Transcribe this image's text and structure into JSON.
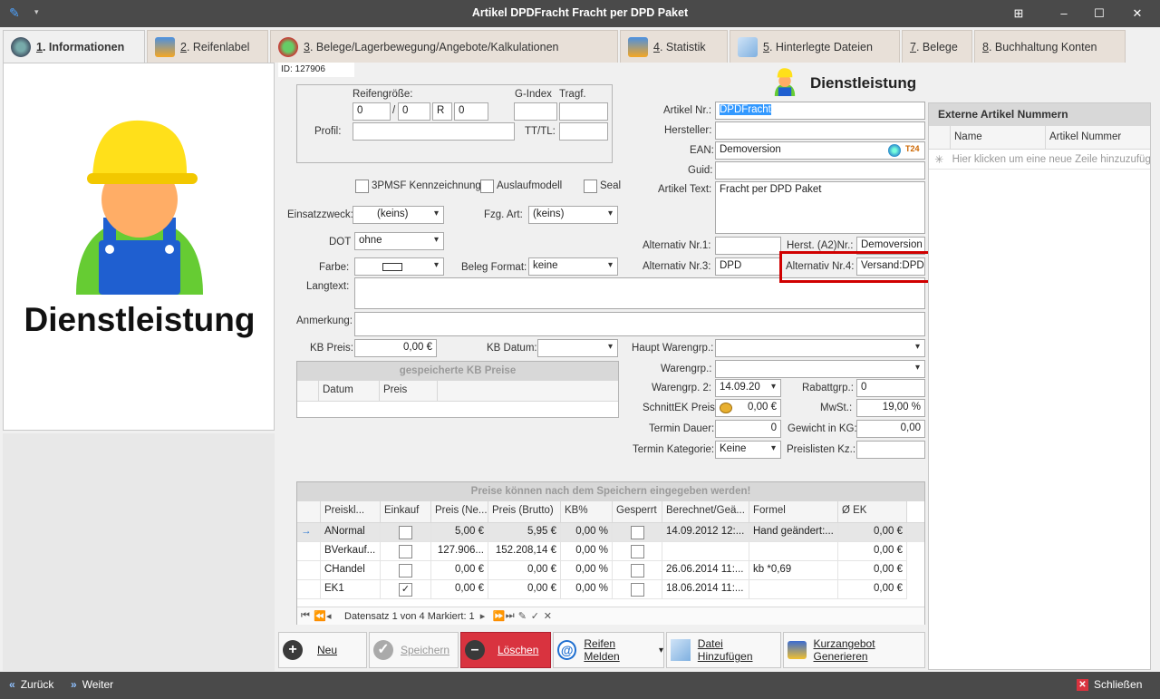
{
  "window": {
    "title": "Artikel DPDFracht Fracht per DPD Paket"
  },
  "tabs": [
    {
      "num": "1",
      "label": ". Informationen"
    },
    {
      "num": "2",
      "label": ". Reifenlabel"
    },
    {
      "num": "3",
      "label": ". Belege/Lagerbewegung/Angebote/Kalkulationen"
    },
    {
      "num": "4",
      "label": ". Statistik"
    },
    {
      "num": "5",
      "label": ". Hinterlegte Dateien"
    },
    {
      "num": "7",
      "label": ". Belege"
    },
    {
      "num": "8",
      "label": ". Buchhaltung Konten"
    }
  ],
  "left": {
    "image_caption": "Dienstleistung"
  },
  "form": {
    "id": "ID: 127906",
    "reifengroesse_label": "Reifengröße:",
    "gindex_label": "G-Index",
    "tragf_label": "Tragf.",
    "r1": "0",
    "sep": "/",
    "r2": "0",
    "r3": "R",
    "r4": "0",
    "profil_label": "Profil:",
    "ttl_label": "TT/TL:",
    "cb_3pmsf": "3PMSF Kennzeichnung",
    "cb_auslauf": "Auslaufmodell",
    "cb_seal": "Seal",
    "einsatz_label": "Einsatzzweck:",
    "einsatz_val": "(keins)",
    "fzg_label": "Fzg. Art:",
    "fzg_val": "(keins)",
    "dot_label": "DOT",
    "dot_val": "ohne",
    "farbe_label": "Farbe:",
    "belegformat_label": "Beleg Format:",
    "belegformat_val": "keine",
    "langtext_label": "Langtext:",
    "anmerkung_label": "Anmerkung:",
    "kbpreis_label": "KB Preis:",
    "kbpreis_val": "0,00 €",
    "kbdatum_label": "KB Datum:",
    "kb_grid_title": "gespeicherte KB Preise",
    "kb_cols": [
      "Datum",
      "Preis"
    ]
  },
  "right": {
    "type_label": "Dienstleistung",
    "artnr_label": "Artikel Nr.:",
    "artnr_val": "DPDFracht",
    "hersteller_label": "Hersteller:",
    "ean_label": "EAN:",
    "ean_val": "Demoversion",
    "guid_label": "Guid:",
    "arttext_label": "Artikel Text:",
    "arttext_val": "Fracht per DPD Paket",
    "alt1_label": "Alternativ Nr.1:",
    "herst_label": "Herst. (A2)Nr.:",
    "herst_val": "Demoversion",
    "alt3_label": "Alternativ Nr.3:",
    "alt3_val": "DPD",
    "alt4_label": "Alternativ Nr.4:",
    "alt4_val": "Versand:DPD",
    "hauptwg_label": "Haupt Warengrp.:",
    "wg_label": "Warengrp.:",
    "wg2_label": "Warengrp. 2:",
    "wg2_val": "14.09.20",
    "rabatt_label": "Rabattgrp.:",
    "rabatt_val": "0",
    "schnittek_label": "SchnittEK Preis:",
    "schnittek_val": "0,00 €",
    "mwst_label": "MwSt.:",
    "mwst_val": "19,00 %",
    "termindauer_label": "Termin Dauer:",
    "termindauer_val": "0",
    "gewicht_label": "Gewicht in KG:",
    "gewicht_val": "0,00",
    "terminkat_label": "Termin Kategorie:",
    "terminkat_val": "Keine",
    "preislisten_label": "Preislisten Kz.:"
  },
  "extern": {
    "title": "Externe Artikel Nummern",
    "cols": [
      "Name",
      "Artikel Nummer"
    ],
    "newrow": "Hier klicken um eine neue Zeile hinzuzufügen"
  },
  "prices": {
    "title": "Preise können nach dem Speichern eingegeben werden!",
    "cols": [
      "Preiskl...",
      "Einkauf",
      "Preis (Ne...",
      "Preis (Brutto)",
      "KB%",
      "Gesperrt",
      "Berechnet/Geä...",
      "Formel",
      "Ø EK"
    ],
    "rows": [
      {
        "name": "ANormal",
        "einkauf": false,
        "netto": "5,00 €",
        "brutto": "5,95 €",
        "kb": "0,00 %",
        "gesperrt": false,
        "berechnet": "14.09.2012 12:...",
        "formel": "Hand geändert:...",
        "ek": "0,00 €"
      },
      {
        "name": "BVerkauf...",
        "einkauf": false,
        "netto": "127.906...",
        "brutto": "152.208,14 €",
        "kb": "0,00 %",
        "gesperrt": false,
        "berechnet": "",
        "formel": "",
        "ek": "0,00 €"
      },
      {
        "name": "CHandel",
        "einkauf": false,
        "netto": "0,00 €",
        "brutto": "0,00 €",
        "kb": "0,00 %",
        "gesperrt": false,
        "berechnet": "26.06.2014 11:...",
        "formel": "kb *0,69",
        "ek": "0,00 €"
      },
      {
        "name": "EK1",
        "einkauf": true,
        "netto": "0,00 €",
        "brutto": "0,00 €",
        "kb": "0,00 %",
        "gesperrt": false,
        "berechnet": "18.06.2014 11:...",
        "formel": "",
        "ek": "0,00 €"
      }
    ],
    "nav": "Datensatz 1 von 4 Markiert: 1"
  },
  "actions": {
    "neu": "Neu",
    "speichern": "Speichern",
    "loeschen": "Löschen",
    "reifen": "Reifen Melden",
    "datei": "Datei Hinzufügen",
    "kurzangebot": "Kurzangebot Generieren"
  },
  "status": {
    "back": "Zurück",
    "next": "Weiter",
    "close": "Schließen"
  }
}
